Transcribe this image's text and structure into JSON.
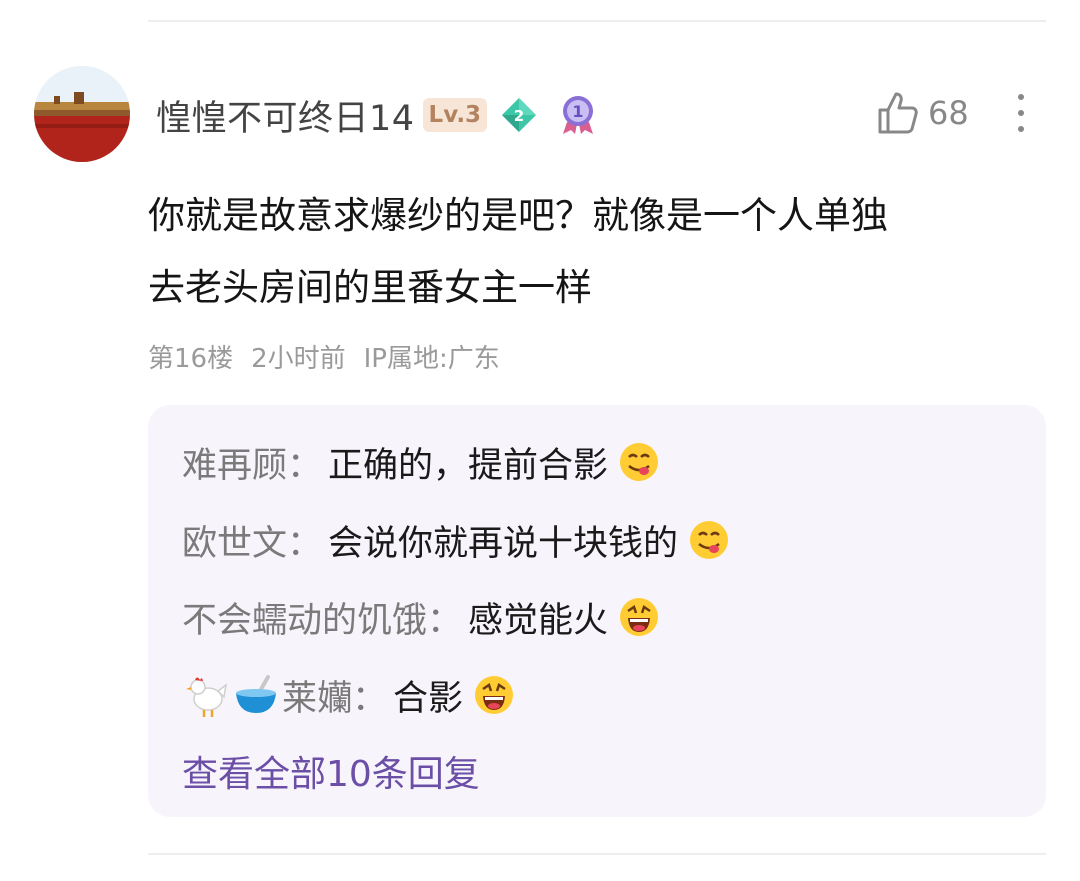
{
  "comment": {
    "username": "惶惶不可终日14",
    "level_badge": "Lv.3",
    "gem_badge_number": "2",
    "medal_badge_number": "1",
    "like_count": "68",
    "content_line1": "你就是故意求爆纱的是吧？就像是一个人单独",
    "content_line2": "去老头房间的里番女主一样",
    "floor": "第16楼",
    "time": "2小时前",
    "ip_location": "IP属地:广东"
  },
  "replies": {
    "separator": "：",
    "items": [
      {
        "author": "难再顾",
        "text": "正确的，提前合影",
        "emoji": "yum-face-emoji"
      },
      {
        "author": "欧世文",
        "text": "会说你就再说十块钱的",
        "emoji": "yum-face-emoji"
      },
      {
        "author": "不会蠕动的饥饿",
        "text": "感觉能火",
        "emoji": "grinning-face-emoji"
      },
      {
        "author": "莱孏",
        "author_prefix_emojis": [
          "chicken-emoji",
          "bowl-with-spoon-emoji"
        ],
        "text": "合影",
        "emoji": "grinning-face-emoji"
      }
    ],
    "view_all": "查看全部10条回复"
  },
  "colors": {
    "reply_bg": "#f8f4fc",
    "view_all_link": "#6b4fa6",
    "level_badge_bg": "#f7e6d8",
    "level_badge_text": "#b3825e",
    "gem": "#3cc7a8",
    "medal": "#8a6fd6"
  }
}
